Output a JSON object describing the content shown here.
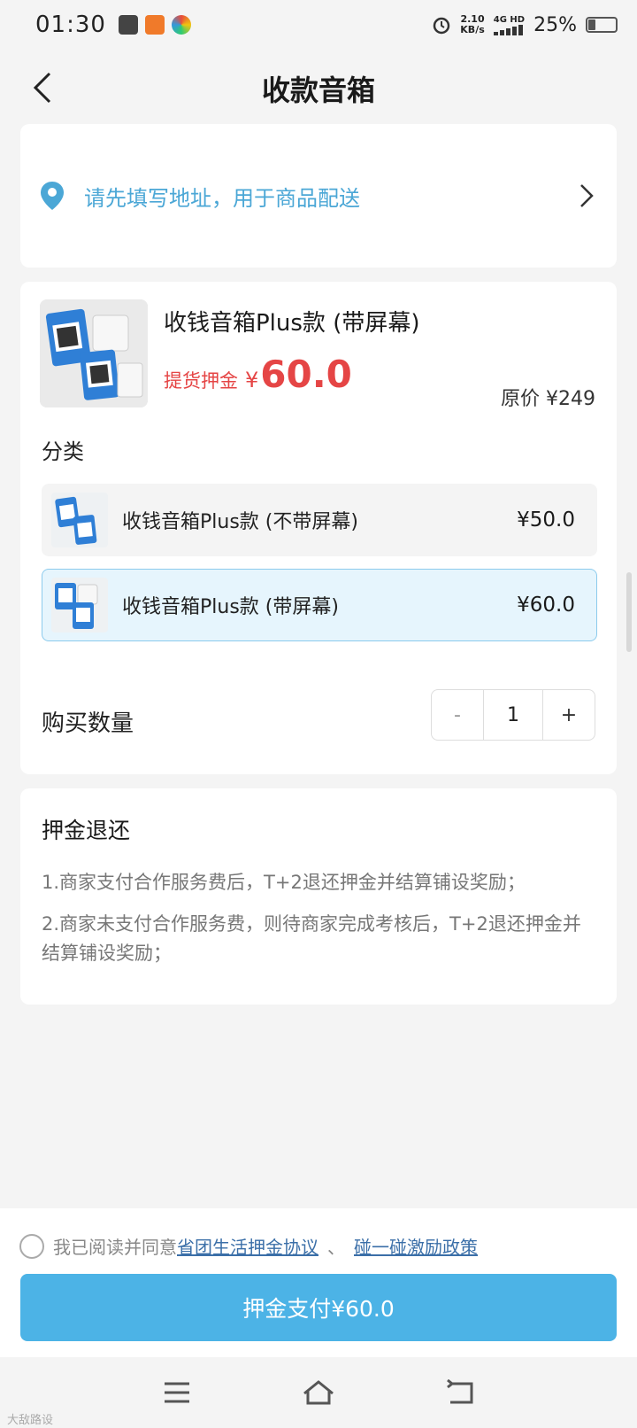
{
  "status": {
    "time": "01:30",
    "net_speed_value": "2.10",
    "net_speed_unit": "KB/s",
    "net_type": "4G HD",
    "battery": "25%",
    "battery_level": 0.25
  },
  "header": {
    "title": "收款音箱"
  },
  "address": {
    "prompt": "请先填写地址，用于商品配送"
  },
  "product": {
    "name": "收钱音箱Plus款 (带屏幕)",
    "deposit_label": "提货押金",
    "currency": "¥",
    "deposit_price": "60.0",
    "original_price": "原价 ¥249",
    "category_label": "分类",
    "variants": [
      {
        "label": "收钱音箱Plus款 (不带屏幕)",
        "price": "¥50.0",
        "selected": false
      },
      {
        "label": "收钱音箱Plus款 (带屏幕)",
        "price": "¥60.0",
        "selected": true
      }
    ],
    "quantity_label": "购买数量",
    "quantity": "1",
    "minus": "-",
    "plus": "+"
  },
  "refund": {
    "title": "押金退还",
    "items": [
      "1.商家支付合作服务费后，T+2退还押金并结算铺设奖励；",
      "2.商家未支付合作服务费，则待商家完成考核后，T+2退还押金并结算铺设奖励；"
    ]
  },
  "agreement": {
    "prefix": "我已阅读并同意",
    "link1": "省团生活押金协议",
    "separator": "、",
    "link2": "碰一碰激励政策"
  },
  "pay_button": "押金支付¥60.0",
  "watermark": "大敌路设",
  "colors": {
    "accent": "#4cb3e6",
    "price_red": "#e54545",
    "address_blue": "#4ba7d6",
    "link_blue": "#3b6fa8"
  }
}
